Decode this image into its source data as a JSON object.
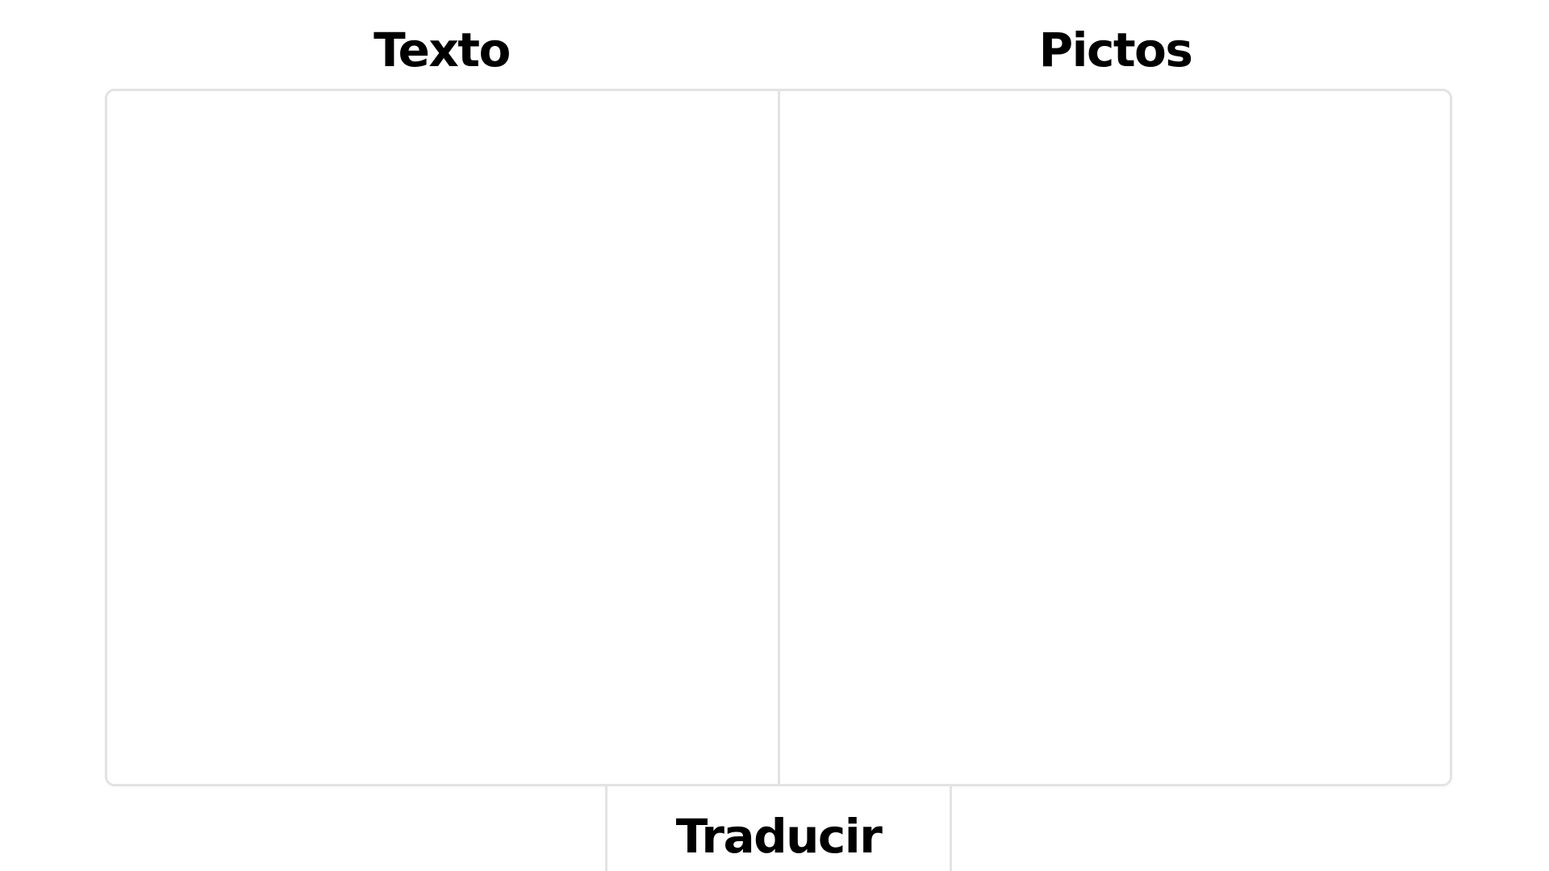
{
  "headings": {
    "text_label": "Texto",
    "pictos_label": "Pictos"
  },
  "text_panel": {
    "value": "",
    "placeholder": ""
  },
  "pictos_panel": {
    "items": []
  },
  "translate_button": {
    "label": "Traducir"
  },
  "colors": {
    "background": "#ffffff",
    "border": "#e3e3e3",
    "text": "#000000"
  }
}
